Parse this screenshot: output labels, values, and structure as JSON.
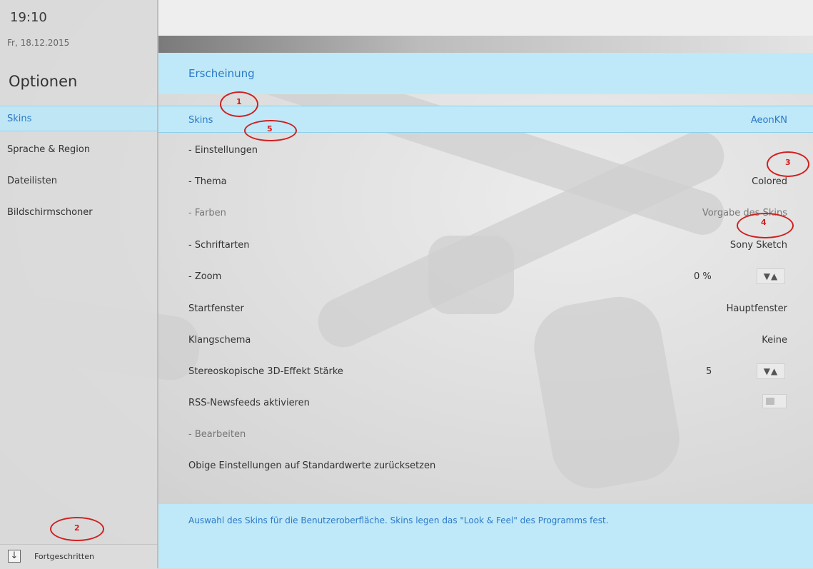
{
  "status": {
    "clock": "19:10",
    "date": "Fr, 18.12.2015"
  },
  "sidebar": {
    "title": "Optionen",
    "items": [
      {
        "label": "Skins",
        "active": true
      },
      {
        "label": "Sprache & Region",
        "active": false
      },
      {
        "label": "Dateilisten",
        "active": false
      },
      {
        "label": "Bildschirmschoner",
        "active": false
      }
    ],
    "advanced_label": "Fortgeschritten"
  },
  "main": {
    "section_title": "Erscheinung",
    "skins": {
      "label": "Skins",
      "value": "AeonKN"
    },
    "rows": [
      {
        "label": "- Einstellungen",
        "value": ""
      },
      {
        "label": "- Thema",
        "value": "Colored"
      },
      {
        "label": "- Farben",
        "value": "Vorgabe des Skins",
        "dim": true
      },
      {
        "label": "- Schriftarten",
        "value": "Sony Sketch"
      },
      {
        "label": "- Zoom",
        "value": "0 %"
      },
      {
        "label": "Startfenster",
        "value": "Hauptfenster"
      },
      {
        "label": "Klangschema",
        "value": "Keine"
      },
      {
        "label": "Stereoskopische 3D-Effekt Stärke",
        "value": "5"
      },
      {
        "label": "RSS-Newsfeeds aktivieren",
        "value": ""
      },
      {
        "label": "- Bearbeiten",
        "value": "",
        "dim": true
      },
      {
        "label": "Obige Einstellungen auf Standardwerte zurücksetzen",
        "value": ""
      }
    ],
    "footer_text": "Auswahl des Skins für die Benutzeroberfläche. Skins legen das \"Look & Feel\" des Programms fest."
  },
  "annotations": [
    "1",
    "2",
    "3",
    "4",
    "5"
  ],
  "colors": {
    "accent": "#2b79c7",
    "highlight": "#bfe9f9",
    "annotation": "#d02020"
  }
}
